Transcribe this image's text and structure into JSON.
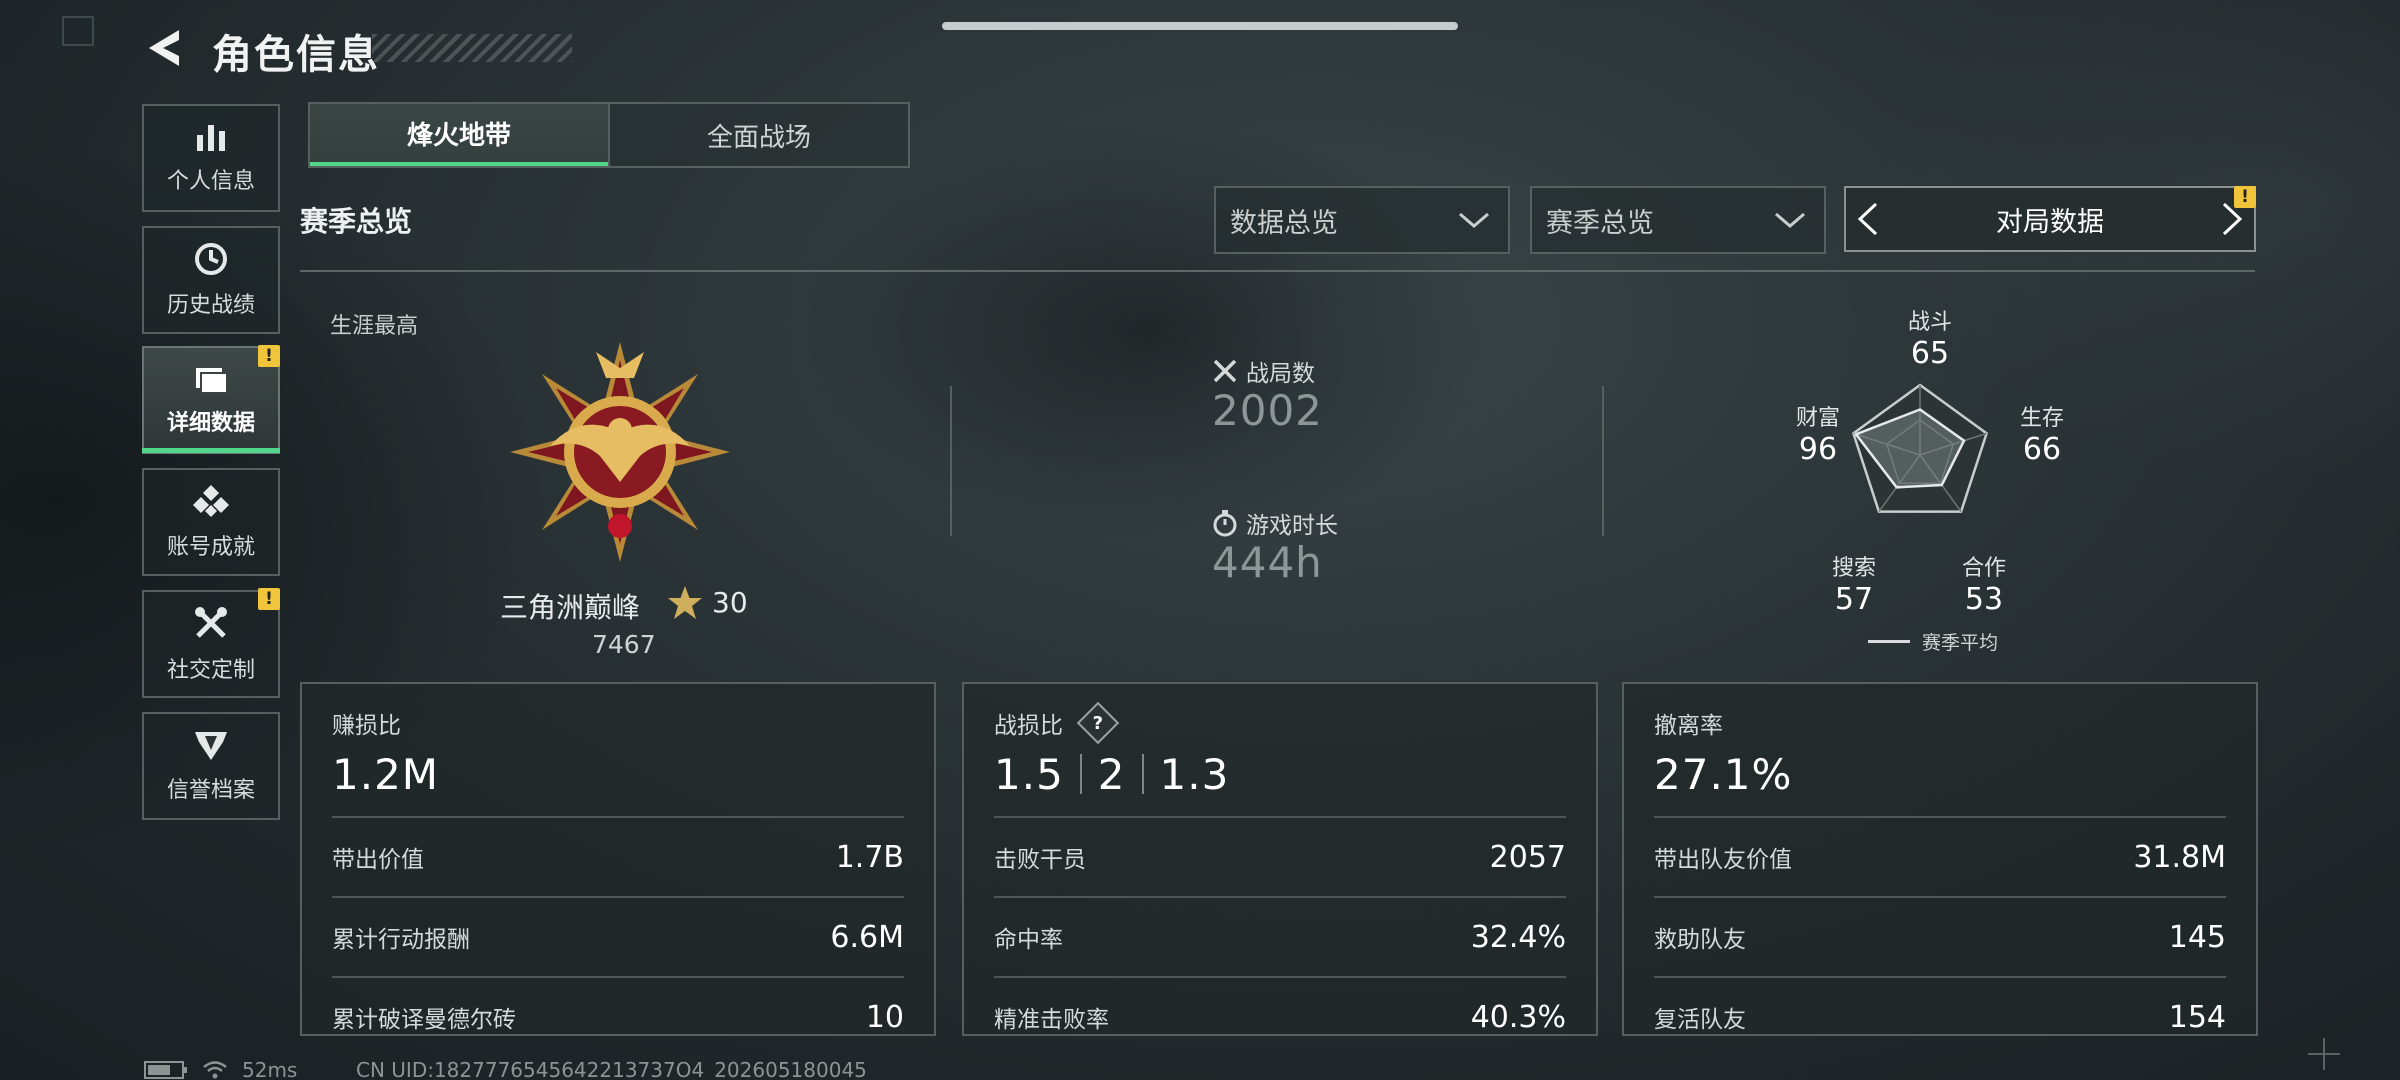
{
  "header": {
    "title": "角色信息"
  },
  "sidebar": {
    "items": [
      {
        "label": "个人信息",
        "icon": "bar-chart-icon",
        "badge": ""
      },
      {
        "label": "历史战绩",
        "icon": "history-clock-icon",
        "badge": ""
      },
      {
        "label": "详细数据",
        "icon": "folder-icon",
        "badge": "!",
        "active": true
      },
      {
        "label": "账号成就",
        "icon": "achievement-icon",
        "badge": ""
      },
      {
        "label": "社交定制",
        "icon": "wrench-icon",
        "badge": "!"
      },
      {
        "label": "信誉档案",
        "icon": "credit-emblem-icon",
        "badge": ""
      }
    ]
  },
  "mode_tabs": [
    {
      "label": "烽火地带",
      "active": true
    },
    {
      "label": "全面战场",
      "active": false
    }
  ],
  "section": {
    "title": "赛季总览"
  },
  "filters": {
    "dropdown1": "数据总览",
    "dropdown2": "赛季总览",
    "pager_label": "对局数据",
    "pager_badge": "!"
  },
  "career": {
    "label": "生涯最高",
    "rank_name": "三角洲巅峰",
    "stars": "30",
    "score": "7467"
  },
  "summary": {
    "matches_label": "战局数",
    "matches_value": "2002",
    "playtime_label": "游戏时长",
    "playtime_value": "444h"
  },
  "radar": {
    "axes": [
      {
        "label": "战斗",
        "value": "65"
      },
      {
        "label": "生存",
        "value": "66"
      },
      {
        "label": "合作",
        "value": "53"
      },
      {
        "label": "搜索",
        "value": "57"
      },
      {
        "label": "财富",
        "value": "96"
      }
    ],
    "legend": "赛季平均"
  },
  "cards": [
    {
      "title": "赚损比",
      "big": "1.2M",
      "rows": [
        {
          "k": "带出价值",
          "v": "1.7B"
        },
        {
          "k": "累计行动报酬",
          "v": "6.6M"
        },
        {
          "k": "累计破译曼德尔砖",
          "v": "10"
        }
      ]
    },
    {
      "title": "战损比",
      "help": "?",
      "big_parts": [
        "1.5",
        "2",
        "1.3"
      ],
      "rows": [
        {
          "k": "击败干员",
          "v": "2057"
        },
        {
          "k": "命中率",
          "v": "32.4%"
        },
        {
          "k": "精准击败率",
          "v": "40.3%"
        }
      ]
    },
    {
      "title": "撤离率",
      "big": "27.1%",
      "rows": [
        {
          "k": "带出队友价值",
          "v": "31.8M"
        },
        {
          "k": "救助队友",
          "v": "145"
        },
        {
          "k": "复活队友",
          "v": "154"
        }
      ]
    }
  ],
  "statusbar": {
    "ping": "52ms",
    "uid": "CN UID:1827776545642213737O4_202605180045"
  },
  "colors": {
    "accent": "#51d68c",
    "warning": "#f0c43b",
    "medal_gold": "#d8a94a",
    "medal_red": "#8a1a22"
  }
}
